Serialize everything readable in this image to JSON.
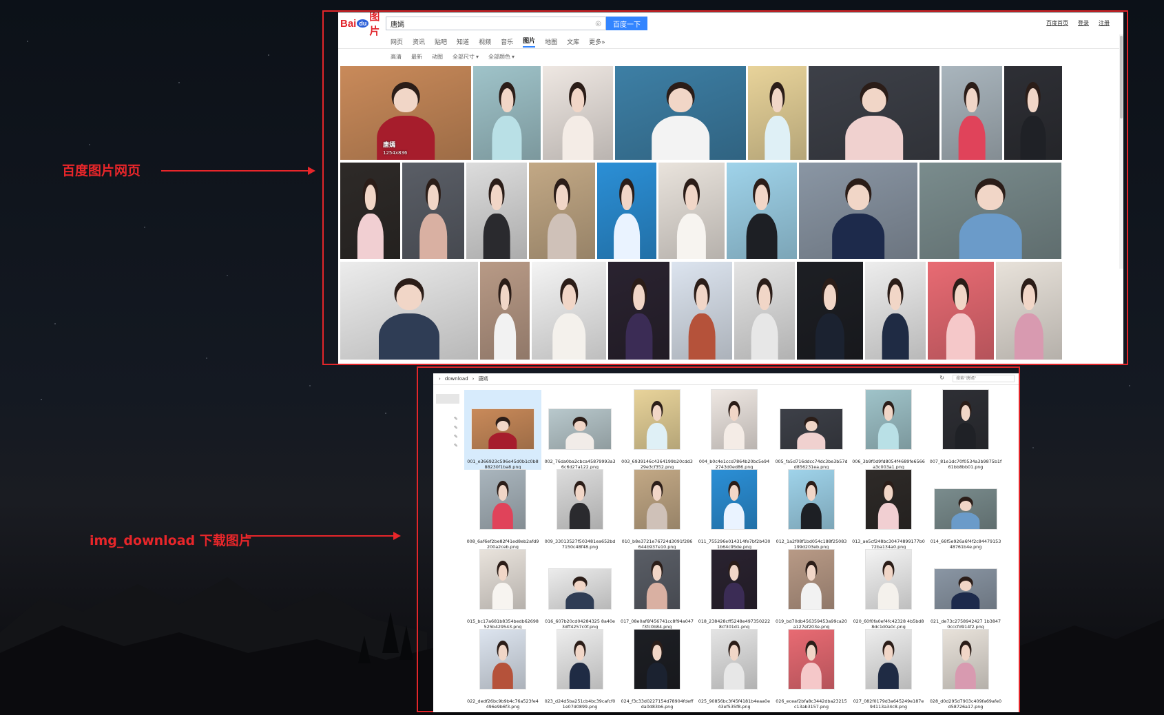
{
  "annotations": {
    "baidu_label": "百度图片网页",
    "download_label": "img_download 下载图片"
  },
  "baidu": {
    "logo_text": "Bai",
    "logo_du": "du",
    "logo_suffix": "图片",
    "search_value": "唐嫣",
    "search_button": "百度一下",
    "top_links": [
      "百度首页",
      "登录",
      "注册"
    ],
    "nav_tabs": [
      {
        "label": "网页",
        "active": false
      },
      {
        "label": "资讯",
        "active": false
      },
      {
        "label": "贴吧",
        "active": false
      },
      {
        "label": "知道",
        "active": false
      },
      {
        "label": "视频",
        "active": false
      },
      {
        "label": "音乐",
        "active": false
      },
      {
        "label": "图片",
        "active": true
      },
      {
        "label": "地图",
        "active": false
      },
      {
        "label": "文库",
        "active": false
      },
      {
        "label": "更多»",
        "active": false
      }
    ],
    "filters": [
      "高清",
      "最新",
      "动图",
      "全部尺寸",
      "全部颜色"
    ],
    "first_caption_name": "唐嫣",
    "first_caption_size": "1254x836",
    "colors": {
      "search_button": "#3385ff",
      "logo_red": "#e1242b"
    }
  },
  "explorer": {
    "path": [
      "download",
      "唐嫣"
    ],
    "search_placeholder": "搜索\"唐嫣\"",
    "files": [
      "001_e366923c596e45d0b1c0b888230f1ba8.png",
      "002_76da0ba2cbca45879993a36c6d27a122.png",
      "003_6939146c4364199b20cdd329e3cf352.png",
      "004_b0c4e1ccd7864b20bc5e942743d0ed86.png",
      "005_fa5d716ddcc74dc3be3b57dd856231ea.png",
      "006_3b9f0d9fd8054f4689fe6566a3c003a1.png",
      "007_81e1dc70f0534a3b9875b1f61bb8bb01.png",
      "008_6af6ef2be82f41ed8eb2afd9200a2ceb.png",
      "009_33013527f503481ea652bd7150c48f48.png",
      "010_b8e3721e76724d3091f286644b937e10.png",
      "011_755296e014314fe7bf2b4301b64c95de.png",
      "012_1a2f08f1bd054c188f25083199d203eb.png",
      "013_ae5cf248bc30474899177b072ba134a0.png",
      "014_66f5e926a6f4f2c8447915348761b4e.png",
      "015_bc17a681b8354bedb62698525b429543.png",
      "016_607b20cd04284325 8a40e3dff4257c0f.png",
      "017_08e0af6f456741cc8f94a047f3fc0b84.png",
      "018_238428cff5248e4973502228cf301d1.png",
      "019_bd70db456359453a99ca20a127ef203e.png",
      "020_60f0fa0ef4fc42328 4b5bd88dc1d0a0c.png",
      "021_de73c2758942427 1b38470cccfd914f2.png",
      "022_dedf26bc9b9b4c76a523fe4496e9b6f3.png",
      "023_d24d5ba251cb4bc39cafcf01e07d0899.png",
      "024_f3c33d0227154d78904fdeffda0d83b6.png",
      "025_90856bc3f45f4181b4eaa0e43ef535f8.png",
      "026_eceaf2bfa8c3442dba23215c13ab3157.png",
      "027_082f0179d3a645249e187e94113a34c8.png",
      "028_d0d295d7903c409fa69afe0d58726a17.png"
    ]
  }
}
